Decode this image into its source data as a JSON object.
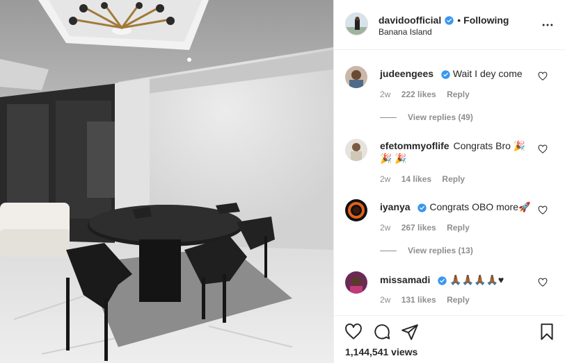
{
  "post": {
    "username": "davidoofficial",
    "following_label": "Following",
    "separator": "•",
    "location": "Banana Island",
    "views": "1,144,541 views"
  },
  "comments": [
    {
      "username": "judeengees",
      "verified": true,
      "text": "Wait I dey come",
      "age": "2w",
      "likes": "222 likes",
      "reply": "Reply",
      "view_replies": "View replies (49)"
    },
    {
      "username": "efetommyoflife",
      "verified": false,
      "text": "Congrats Bro 🎉 🎉 🎉",
      "age": "2w",
      "likes": "14 likes",
      "reply": "Reply"
    },
    {
      "username": "iyanya",
      "verified": true,
      "text": "Congrats OBO more🚀",
      "age": "2w",
      "likes": "267 likes",
      "reply": "Reply",
      "view_replies": "View replies (13)"
    },
    {
      "username": "missamadi",
      "verified": true,
      "text": "🙏🏾🙏🏾🙏🏾🙏🏾♥",
      "age": "2w",
      "likes": "131 likes",
      "reply": "Reply"
    }
  ],
  "icons": {
    "more": "more-options-icon",
    "like": "heart-icon",
    "comment": "comment-icon",
    "share": "share-icon",
    "save": "bookmark-icon",
    "verified": "verified-badge-icon"
  },
  "colors": {
    "verified": "#3897f0",
    "text": "#262626",
    "muted": "#8e8e8e",
    "border": "#efefef"
  }
}
